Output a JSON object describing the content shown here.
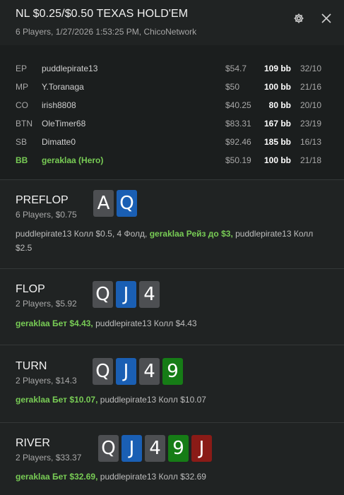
{
  "header": {
    "title": "NL $0.25/$0.50 TEXAS HOLD'EM",
    "subtitle": "6 Players, 1/27/2026 1:53:25 PM, ChicoNetwork"
  },
  "players": [
    {
      "pos": "EP",
      "name": "puddlepirate13",
      "stack": "$54.7",
      "bb": "109 bb",
      "ratio": "32/10"
    },
    {
      "pos": "MP",
      "name": "Y.Toranaga",
      "stack": "$50",
      "bb": "100 bb",
      "ratio": "21/16"
    },
    {
      "pos": "CO",
      "name": "irish8808",
      "stack": "$40.25",
      "bb": "80 bb",
      "ratio": "20/10"
    },
    {
      "pos": "BTN",
      "name": "OleTimer68",
      "stack": "$83.31",
      "bb": "167 bb",
      "ratio": "23/19"
    },
    {
      "pos": "SB",
      "name": "Dimatte0",
      "stack": "$92.46",
      "bb": "185 bb",
      "ratio": "16/13"
    },
    {
      "pos": "BB",
      "name": "geraklaa (Hero)",
      "stack": "$50.19",
      "bb": "100 bb",
      "ratio": "21/18"
    }
  ],
  "streets": {
    "preflop": {
      "name": "PREFLOP",
      "info": "6 Players, $0.75",
      "cards": [
        "A",
        "Q"
      ],
      "a1": "puddlepirate13 Колл $0.5, 4 Фолд, ",
      "a2": "geraklaa Рейз до $3,",
      "a3": " puddlepirate13 Колл $2.5"
    },
    "flop": {
      "name": "FLOP",
      "info": "2 Players, $5.92",
      "cards": [
        "Q",
        "J",
        "4"
      ],
      "a1": "geraklaa Бет $4.43,",
      "a2": " puddlepirate13 Колл $4.43"
    },
    "turn": {
      "name": "TURN",
      "info": "2 Players, $14.3",
      "cards": [
        "Q",
        "J",
        "4",
        "9"
      ],
      "a1": "geraklaa Бет $10.07,",
      "a2": " puddlepirate13 Колл $10.07"
    },
    "river": {
      "name": "RIVER",
      "info": "2 Players, $33.37",
      "cards": [
        "Q",
        "J",
        "4",
        "9",
        "J"
      ],
      "a1": "geraklaa Бет $32.69,",
      "a2": " puddlepirate13 Колл $32.69"
    }
  },
  "colors": {
    "hero": "#78cc55",
    "card_spades": "#4d4f52",
    "card_diamonds": "#1a5fb4",
    "card_clubs": "#167c16",
    "card_hearts": "#8a1b17"
  }
}
